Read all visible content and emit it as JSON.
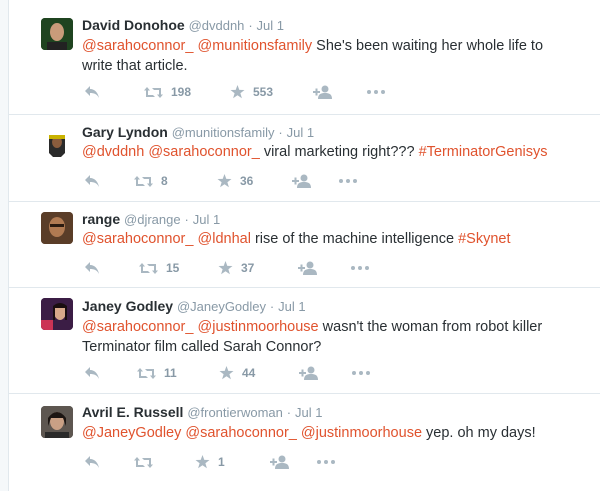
{
  "tweets": [
    {
      "name": "David Donohoe",
      "handle": "@dvddnh",
      "separator": "·",
      "time": "Jul 1",
      "segments": [
        {
          "text": "@sarahoconnor_",
          "kind": "mention"
        },
        {
          "text": " ",
          "kind": "text"
        },
        {
          "text": "@munitionsfamily",
          "kind": "mention"
        },
        {
          "text": " She's been waiting her whole life to write that article.",
          "kind": "text"
        }
      ],
      "retweets": "198",
      "favorites": "553"
    },
    {
      "name": "Gary Lyndon",
      "handle": "@munitionsfamily",
      "separator": "·",
      "time": "Jul 1",
      "segments": [
        {
          "text": "@dvddnh",
          "kind": "mention"
        },
        {
          "text": " ",
          "kind": "text"
        },
        {
          "text": "@sarahoconnor_",
          "kind": "mention"
        },
        {
          "text": " viral marketing right??? ",
          "kind": "text"
        },
        {
          "text": "#TerminatorGenisys",
          "kind": "hashtag"
        }
      ],
      "retweets": "8",
      "favorites": "36"
    },
    {
      "name": "range",
      "handle": "@djrange",
      "separator": "·",
      "time": "Jul 1",
      "segments": [
        {
          "text": "@sarahoconnor_",
          "kind": "mention"
        },
        {
          "text": " ",
          "kind": "text"
        },
        {
          "text": "@ldnhal",
          "kind": "mention"
        },
        {
          "text": " rise of the machine intelligence ",
          "kind": "text"
        },
        {
          "text": "#Skynet",
          "kind": "hashtag"
        }
      ],
      "retweets": "15",
      "favorites": "37"
    },
    {
      "name": "Janey Godley",
      "handle": "@JaneyGodley",
      "separator": "·",
      "time": "Jul 1",
      "segments": [
        {
          "text": "@sarahoconnor_",
          "kind": "mention"
        },
        {
          "text": " ",
          "kind": "text"
        },
        {
          "text": "@justinmoorhouse",
          "kind": "mention"
        },
        {
          "text": " wasn't the woman from robot killer Terminator film called  Sarah Connor?",
          "kind": "text"
        }
      ],
      "retweets": "11",
      "favorites": "44"
    },
    {
      "name": "Avril E. Russell",
      "handle": "@frontierwoman",
      "separator": "·",
      "time": "Jul 1",
      "segments": [
        {
          "text": "@JaneyGodley",
          "kind": "mention"
        },
        {
          "text": " ",
          "kind": "text"
        },
        {
          "text": "@sarahoconnor_",
          "kind": "mention"
        },
        {
          "text": " ",
          "kind": "text"
        },
        {
          "text": "@justinmoorhouse",
          "kind": "mention"
        },
        {
          "text": " yep. oh my days!",
          "kind": "text"
        }
      ],
      "retweets": "",
      "favorites": "1"
    }
  ],
  "colors": {
    "link": "#e0532e",
    "icon": "#aab8c2",
    "count": "#8899a6",
    "meta": "#8899a6",
    "text": "#292f33",
    "divider": "#e1e8ed"
  },
  "icons": [
    "reply-icon",
    "retweet-icon",
    "favorite-icon",
    "follow-icon",
    "more-icon"
  ]
}
